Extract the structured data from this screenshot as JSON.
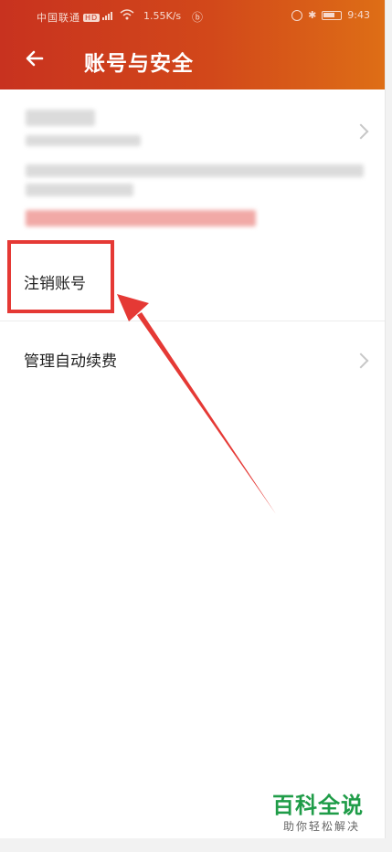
{
  "status_bar": {
    "carrier": "中国联通",
    "hd": "HD",
    "speed": "1.55K/s",
    "extra": "ⓑ",
    "time": "9:43"
  },
  "header": {
    "title": "账号与安全",
    "accent_color": "#d2481a"
  },
  "rows": [
    {
      "label": "注销账号"
    },
    {
      "label": "管理自动续费"
    }
  ],
  "annotation_color": "#e53935",
  "watermark": {
    "title": "百科全说",
    "subtitle": "助你轻松解决"
  }
}
